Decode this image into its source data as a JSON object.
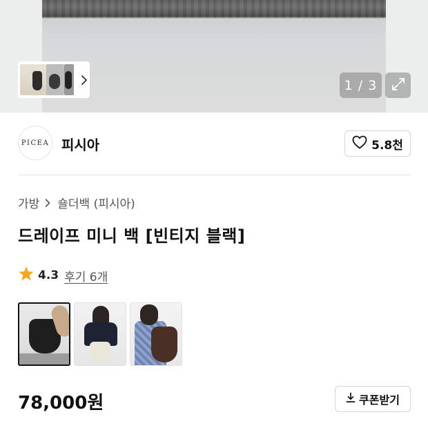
{
  "gallery": {
    "counter": "1 / 3",
    "thumbnail_strip": {
      "icon": "chevron-right-icon"
    },
    "expand": {
      "icon": "expand-icon"
    }
  },
  "brand": {
    "logo_text": "PICEA",
    "name": "피시아",
    "like_count": "5.8천",
    "like_icon": "heart-outline-icon"
  },
  "breadcrumb": {
    "items": [
      "가방",
      "숄더백 (피시아)"
    ],
    "separator_icon": "chevron-right-icon"
  },
  "product": {
    "title": "드레이프 미니 백 [빈티지 블랙]",
    "rating": "4.3",
    "rating_icon": "star-icon",
    "star_color": "#f5a623",
    "review_link": "후기 6개",
    "options": [
      {
        "name": "black-bag-photo",
        "selected": true
      },
      {
        "name": "ivory-bag-model-photo",
        "selected": false
      },
      {
        "name": "brown-bag-model-photo",
        "selected": false
      }
    ],
    "price": "78,000원"
  },
  "coupon": {
    "label": "쿠폰받기",
    "icon": "download-icon"
  }
}
